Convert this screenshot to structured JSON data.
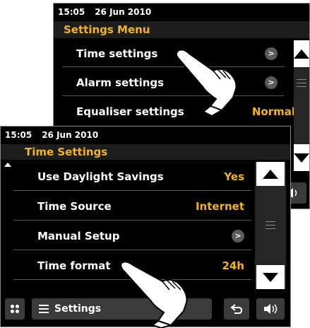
{
  "back_screen": {
    "status": {
      "time": "15:05",
      "date": "26 Jun 2010"
    },
    "title": "Settings Menu",
    "rows": [
      {
        "label": "Time settings",
        "value": ">",
        "value_type": "arrow"
      },
      {
        "label": "Alarm settings",
        "value": ">",
        "value_type": "arrow"
      },
      {
        "label": "Equaliser settings",
        "value": "Normal",
        "value_type": "text"
      }
    ]
  },
  "front_screen": {
    "status": {
      "time": "15:05",
      "date": "26 Jun 2010"
    },
    "title": "Time Settings",
    "rows": [
      {
        "label": "Use Daylight Savings",
        "value": "Yes",
        "value_type": "text"
      },
      {
        "label": "Time Source",
        "value": "Internet",
        "value_type": "text"
      },
      {
        "label": "Manual Setup",
        "value": ">",
        "value_type": "arrow"
      },
      {
        "label": "Time format",
        "value": "24h",
        "value_type": "text"
      }
    ],
    "bottom": {
      "menu_label": "Settings"
    }
  },
  "colors": {
    "accent": "#f2b31f",
    "background": "#000000",
    "button": "#3b3b3b"
  },
  "icons": [
    "scroll-up-icon",
    "scroll-down-icon",
    "grid-icon",
    "menu-lines-icon",
    "back-arrow-icon",
    "volume-icon",
    "pointing-hand-icon"
  ]
}
